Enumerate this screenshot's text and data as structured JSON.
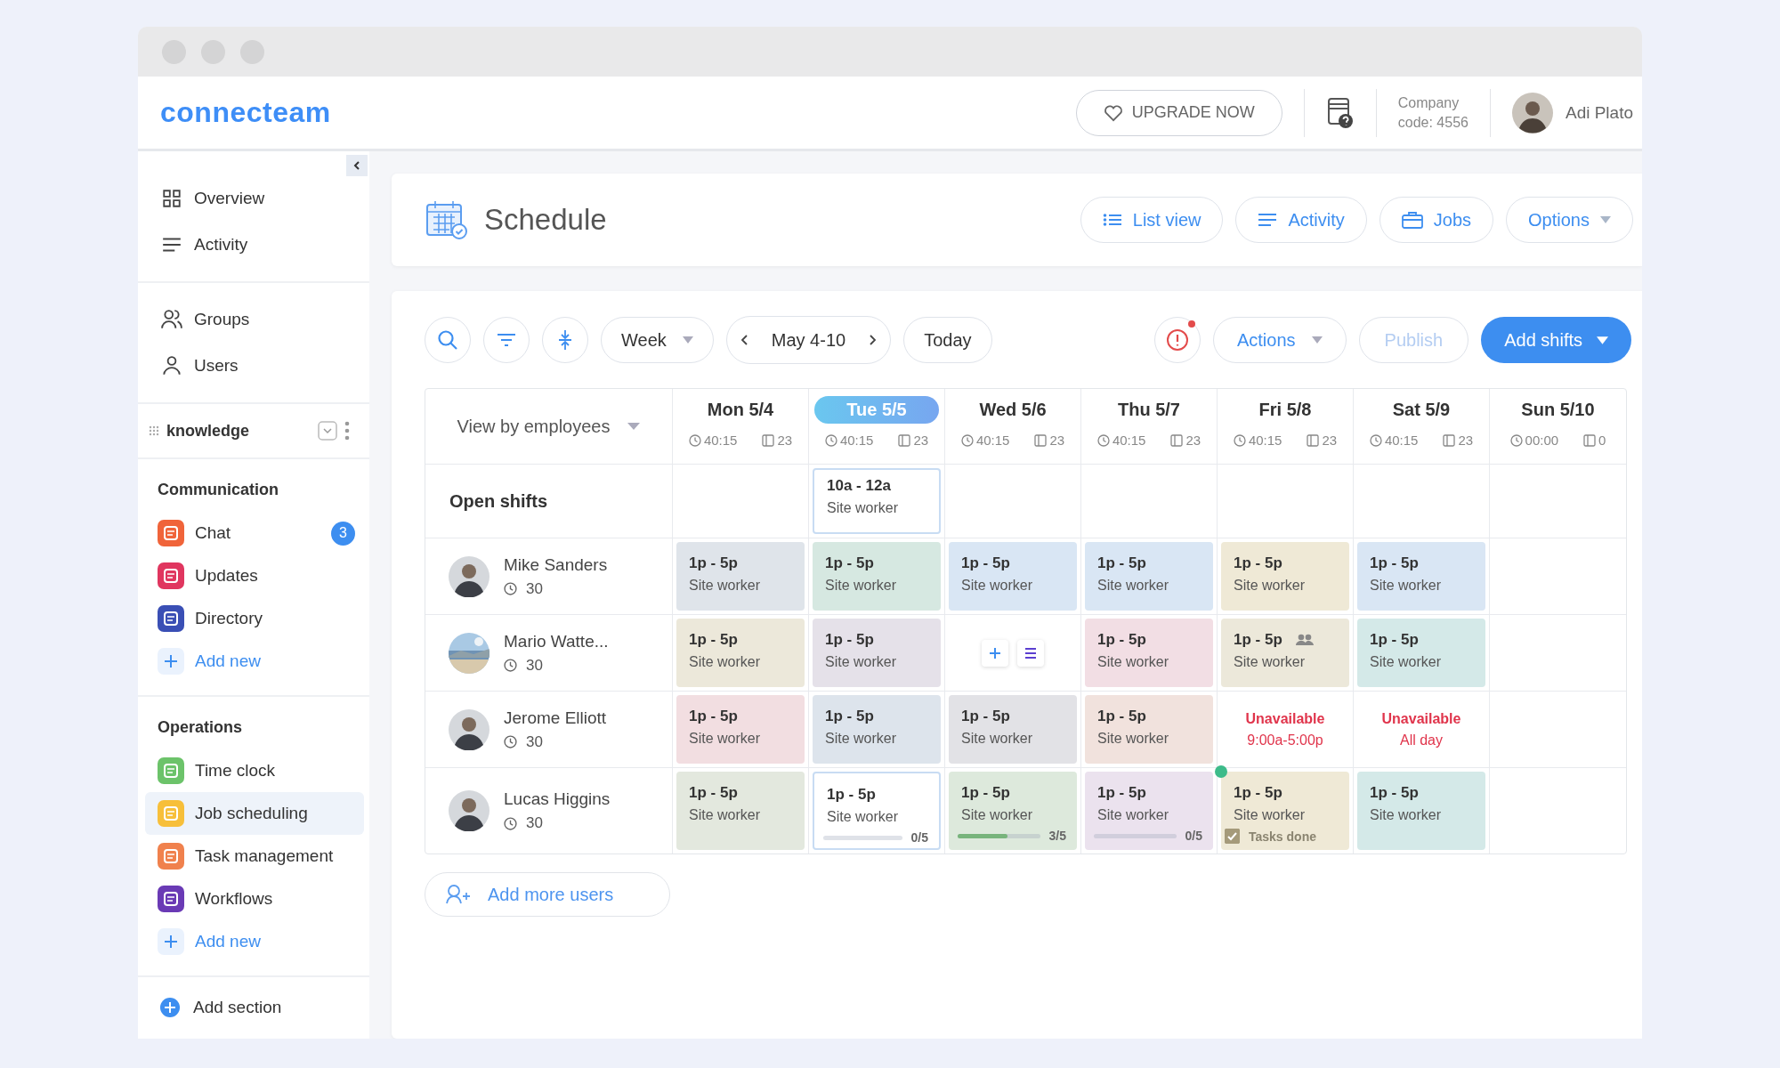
{
  "header": {
    "logo": "connecteam",
    "upgrade": "UPGRADE NOW",
    "company": [
      "Company",
      "code: 4556"
    ],
    "user": "Adi Plato"
  },
  "nav": [
    {
      "items": [
        {
          "label": "Overview",
          "selected": false
        },
        {
          "label": "Activity",
          "selected": false
        }
      ]
    },
    {
      "items": [
        {
          "label": "Groups",
          "selected": false
        },
        {
          "label": "Users",
          "selected": false
        }
      ]
    }
  ],
  "knowledge": {
    "label": "knowledge"
  },
  "sections": [
    {
      "title": "Communication",
      "add": "Add new",
      "items": [
        {
          "label": "Chat",
          "color": "#f0643a",
          "badge": "3",
          "selected": false
        },
        {
          "label": "Updates",
          "color": "#e0365f",
          "selected": false
        },
        {
          "label": "Directory",
          "color": "#3a4fb5",
          "selected": false
        }
      ]
    },
    {
      "title": "Operations",
      "add": "Add new",
      "items": [
        {
          "label": "Time clock",
          "color": "#6cc36a",
          "selected": false
        },
        {
          "label": "Job scheduling",
          "color": "#f7bf3a",
          "selected": true
        },
        {
          "label": "Task management",
          "color": "#f0814d",
          "selected": false
        },
        {
          "label": "Workflows",
          "color": "#6a3ab5",
          "selected": false
        }
      ]
    }
  ],
  "add_section": "Add section",
  "schedule": {
    "title": "Schedule",
    "buttons": [
      "List view",
      "Activity",
      "Jobs",
      "Options"
    ]
  },
  "toolbar": {
    "range_mode": "Week",
    "date_range": "May 4-10",
    "today": "Today",
    "actions": "Actions",
    "publish": {
      "label": "Publish",
      "disabled": true
    },
    "add": "Add shifts",
    "alert_dot": true
  },
  "view_by": "View by employees",
  "days": [
    {
      "label": "Mon 5/4",
      "selected": false,
      "hours": "40:15",
      "count": "23"
    },
    {
      "label": "Tue 5/5",
      "selected": true,
      "hours": "40:15",
      "count": "23"
    },
    {
      "label": "Wed 5/6",
      "selected": false,
      "hours": "40:15",
      "count": "23"
    },
    {
      "label": "Thu 5/7",
      "selected": false,
      "hours": "40:15",
      "count": "23"
    },
    {
      "label": "Fri 5/8",
      "selected": false,
      "hours": "40:15",
      "count": "23"
    },
    {
      "label": "Sat 5/9",
      "selected": false,
      "hours": "40:15",
      "count": "23"
    },
    {
      "label": "Sun 5/10",
      "selected": false,
      "hours": "00:00",
      "count": "0"
    }
  ],
  "open_shifts": {
    "label": "Open shifts",
    "cells": [
      {
        "kind": "empty"
      },
      {
        "kind": "outlined",
        "time": "10a - 12a",
        "role": "Site worker"
      },
      {
        "kind": "empty"
      },
      {
        "kind": "empty"
      },
      {
        "kind": "empty"
      },
      {
        "kind": "empty"
      },
      {
        "kind": "empty"
      }
    ]
  },
  "employees": [
    {
      "name": "Mike Sanders",
      "kind": "person",
      "hours": "30",
      "cells": [
        {
          "kind": "shift",
          "time": "1p - 5p",
          "role": "Site worker",
          "color": "#dfe4ea"
        },
        {
          "kind": "shift",
          "time": "1p - 5p",
          "role": "Site worker",
          "color": "#d6e8e1"
        },
        {
          "kind": "shift",
          "time": "1p - 5p",
          "role": "Site worker",
          "color": "#d9e6f4"
        },
        {
          "kind": "shift",
          "time": "1p - 5p",
          "role": "Site worker",
          "color": "#d9e6f4"
        },
        {
          "kind": "shift",
          "time": "1p - 5p",
          "role": "Site worker",
          "color": "#efe9d6"
        },
        {
          "kind": "shift",
          "time": "1p - 5p",
          "role": "Site worker",
          "color": "#d9e6f4"
        },
        {
          "kind": "empty"
        }
      ]
    },
    {
      "name": "Mario Watte...",
      "kind": "picture",
      "hours": "30",
      "cells": [
        {
          "kind": "shift",
          "time": "1p - 5p",
          "role": "Site worker",
          "color": "#ece8da"
        },
        {
          "kind": "shift",
          "time": "1p - 5p",
          "role": "Site worker",
          "color": "#e5e1e9"
        },
        {
          "kind": "actions"
        },
        {
          "kind": "shift",
          "time": "1p - 5p",
          "role": "Site worker",
          "color": "#f2dee4"
        },
        {
          "kind": "shift",
          "time": "1p - 5p",
          "role": "Site worker",
          "color": "#ece8da",
          "group": true
        },
        {
          "kind": "shift",
          "time": "1p - 5p",
          "role": "Site worker",
          "color": "#d4e9e8"
        },
        {
          "kind": "empty"
        }
      ]
    },
    {
      "name": "Jerome Elliott",
      "kind": "person",
      "hours": "30",
      "cells": [
        {
          "kind": "shift",
          "time": "1p - 5p",
          "role": "Site worker",
          "color": "#f2dee1"
        },
        {
          "kind": "shift",
          "time": "1p - 5p",
          "role": "Site worker",
          "color": "#dde4ec"
        },
        {
          "kind": "shift",
          "time": "1p - 5p",
          "role": "Site worker",
          "color": "#e2e2e6"
        },
        {
          "kind": "shift",
          "time": "1p - 5p",
          "role": "Site worker",
          "color": "#f1e2dd"
        },
        {
          "kind": "unavailable",
          "title": "Unavailable",
          "detail": "9:00a-5:00p"
        },
        {
          "kind": "unavailable",
          "title": "Unavailable",
          "detail": "All day"
        },
        {
          "kind": "empty"
        }
      ]
    },
    {
      "name": "Lucas Higgins",
      "kind": "person",
      "hours": "30",
      "cells": [
        {
          "kind": "shift",
          "time": "1p - 5p",
          "role": "Site worker",
          "color": "#e3e8de"
        },
        {
          "kind": "outlined",
          "time": "1p - 5p",
          "role": "Site worker",
          "progress": "0/5",
          "level": 0
        },
        {
          "kind": "shift",
          "time": "1p - 5p",
          "role": "Site worker",
          "color": "#dde9dc",
          "progress": "3/5",
          "level": 0.6
        },
        {
          "kind": "shift",
          "time": "1p - 5p",
          "role": "Site worker",
          "color": "#ebe2ee",
          "progress": "0/5",
          "level": 0
        },
        {
          "kind": "shift",
          "time": "1p - 5p",
          "role": "Site worker",
          "color": "#efe9d6",
          "marker": true,
          "tasks": {
            "label": "Tasks done",
            "checked": true
          }
        },
        {
          "kind": "shift",
          "time": "1p - 5p",
          "role": "Site worker",
          "color": "#d4e9e8"
        },
        {
          "kind": "empty"
        }
      ]
    }
  ],
  "add_users": "Add more users"
}
